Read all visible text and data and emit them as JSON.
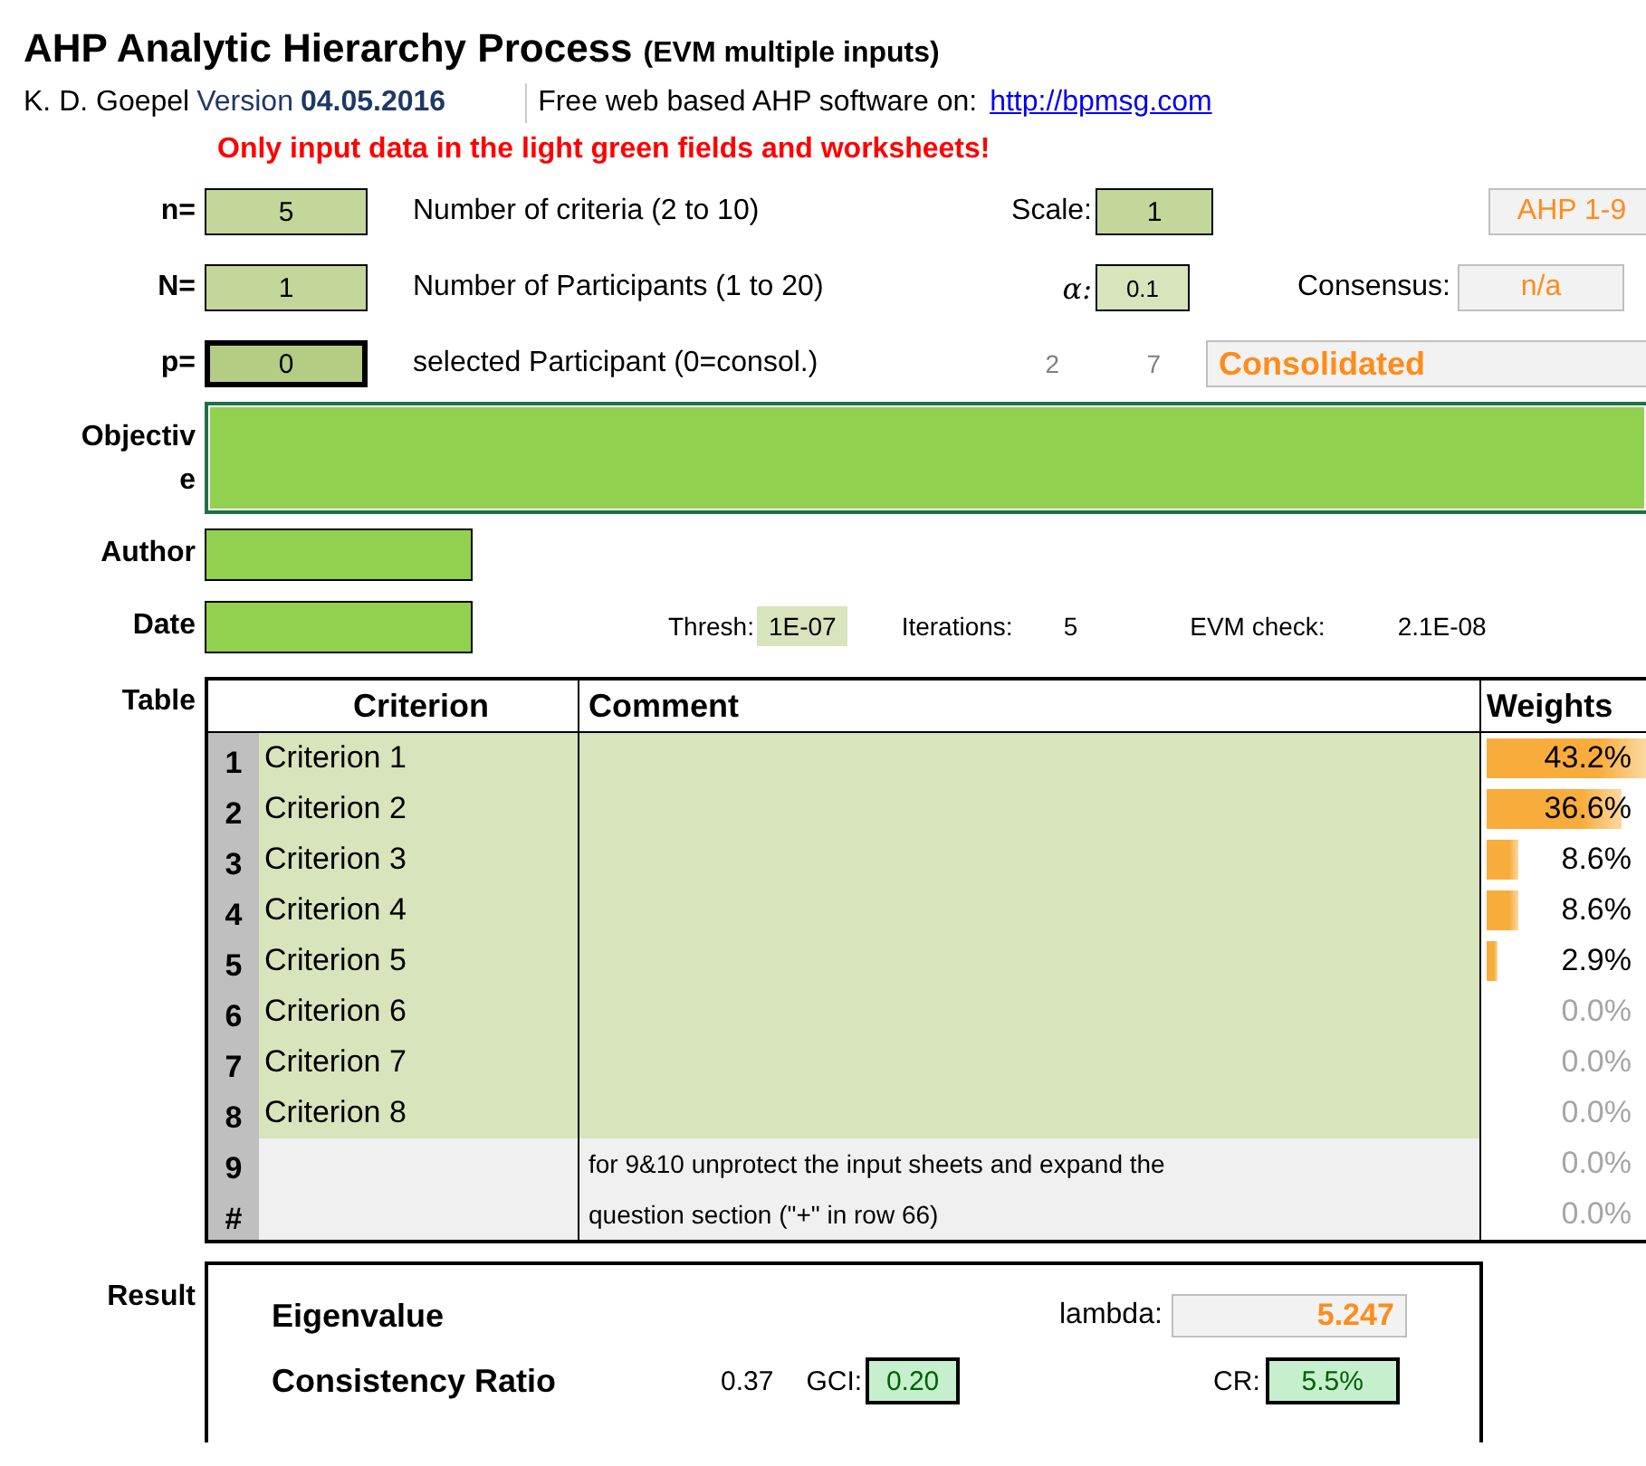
{
  "header": {
    "title": "AHP Analytic Hierarchy Process",
    "title_suffix": "(EVM multiple inputs)",
    "author": "K. D. Goepel",
    "version_label": "Version",
    "version": "04.05.2016",
    "tagline": "Free web based AHP software on:",
    "link": "http://bpmsg.com",
    "notice": "Only input data in the light green fields and worksheets!"
  },
  "settings": [
    {
      "label": "n=",
      "value": "5",
      "selected": false,
      "description": "Number of criteria (2 to 10)",
      "side_label": "Scale:",
      "side_value": "1",
      "far_value": "AHP 1-9"
    },
    {
      "label": "N=",
      "value": "1",
      "selected": false,
      "description": "Number of Participants (1 to 20)",
      "side_label": "α:",
      "side_value": "0.1",
      "far_label": "Consensus:",
      "far_value": "n/a"
    },
    {
      "label": "p=",
      "value": "0",
      "selected": true,
      "description": "selected Participant (0=consol.)",
      "side_label": "2",
      "side_value": "7",
      "far_value": "Consolidated"
    }
  ],
  "objective": {
    "label_lines": [
      "Objectiv",
      "e"
    ]
  },
  "author": {
    "label": "Author"
  },
  "date": {
    "label": "Date"
  },
  "iteration": {
    "thresh_label": "Thresh:",
    "thresh": "1E-07",
    "iterations_label": "Iterations:",
    "iterations": "5",
    "check_label": "EVM check:",
    "check": "2.1E-08"
  },
  "table": {
    "label": "Table",
    "columns": [
      "Criterion",
      "Comment",
      "Weights"
    ],
    "rows": [
      {
        "index": "1",
        "criterion": "Criterion 1",
        "comment": "",
        "editable": true,
        "weight": "43.2%",
        "dimmed": false
      },
      {
        "index": "2",
        "criterion": "Criterion 2",
        "comment": "",
        "editable": true,
        "weight": "36.6%",
        "dimmed": false
      },
      {
        "index": "3",
        "criterion": "Criterion 3",
        "comment": "",
        "editable": true,
        "weight": "8.6%",
        "dimmed": false
      },
      {
        "index": "4",
        "criterion": "Criterion 4",
        "comment": "",
        "editable": true,
        "weight": "8.6%",
        "dimmed": false
      },
      {
        "index": "5",
        "criterion": "Criterion 5",
        "comment": "",
        "editable": true,
        "weight": "2.9%",
        "dimmed": false
      },
      {
        "index": "6",
        "criterion": "Criterion 6",
        "comment": "",
        "editable": true,
        "weight": "0.0%",
        "dimmed": true
      },
      {
        "index": "7",
        "criterion": "Criterion 7",
        "comment": "",
        "editable": true,
        "weight": "0.0%",
        "dimmed": true
      },
      {
        "index": "8",
        "criterion": "Criterion 8",
        "comment": "",
        "editable": true,
        "weight": "0.0%",
        "dimmed": true
      },
      {
        "index": "9",
        "criterion": "",
        "comment": "for 9&10 unprotect the input sheets and expand the",
        "editable": false,
        "weight": "0.0%",
        "dimmed": true
      },
      {
        "index": "#",
        "criterion": "",
        "comment": "question section (\"+\" in row 66)",
        "editable": false,
        "weight": "0.0%",
        "dimmed": true
      }
    ]
  },
  "result": {
    "label": "Result",
    "eigen_label": "Eigenvalue",
    "lambda_label": "lambda:",
    "lambda": "5.247",
    "cr_title": "Consistency Ratio",
    "gci_raw": "0.37",
    "gci_label": "GCI:",
    "gci": "0.20",
    "cr_label": "CR:",
    "cr": "5.5%"
  }
}
